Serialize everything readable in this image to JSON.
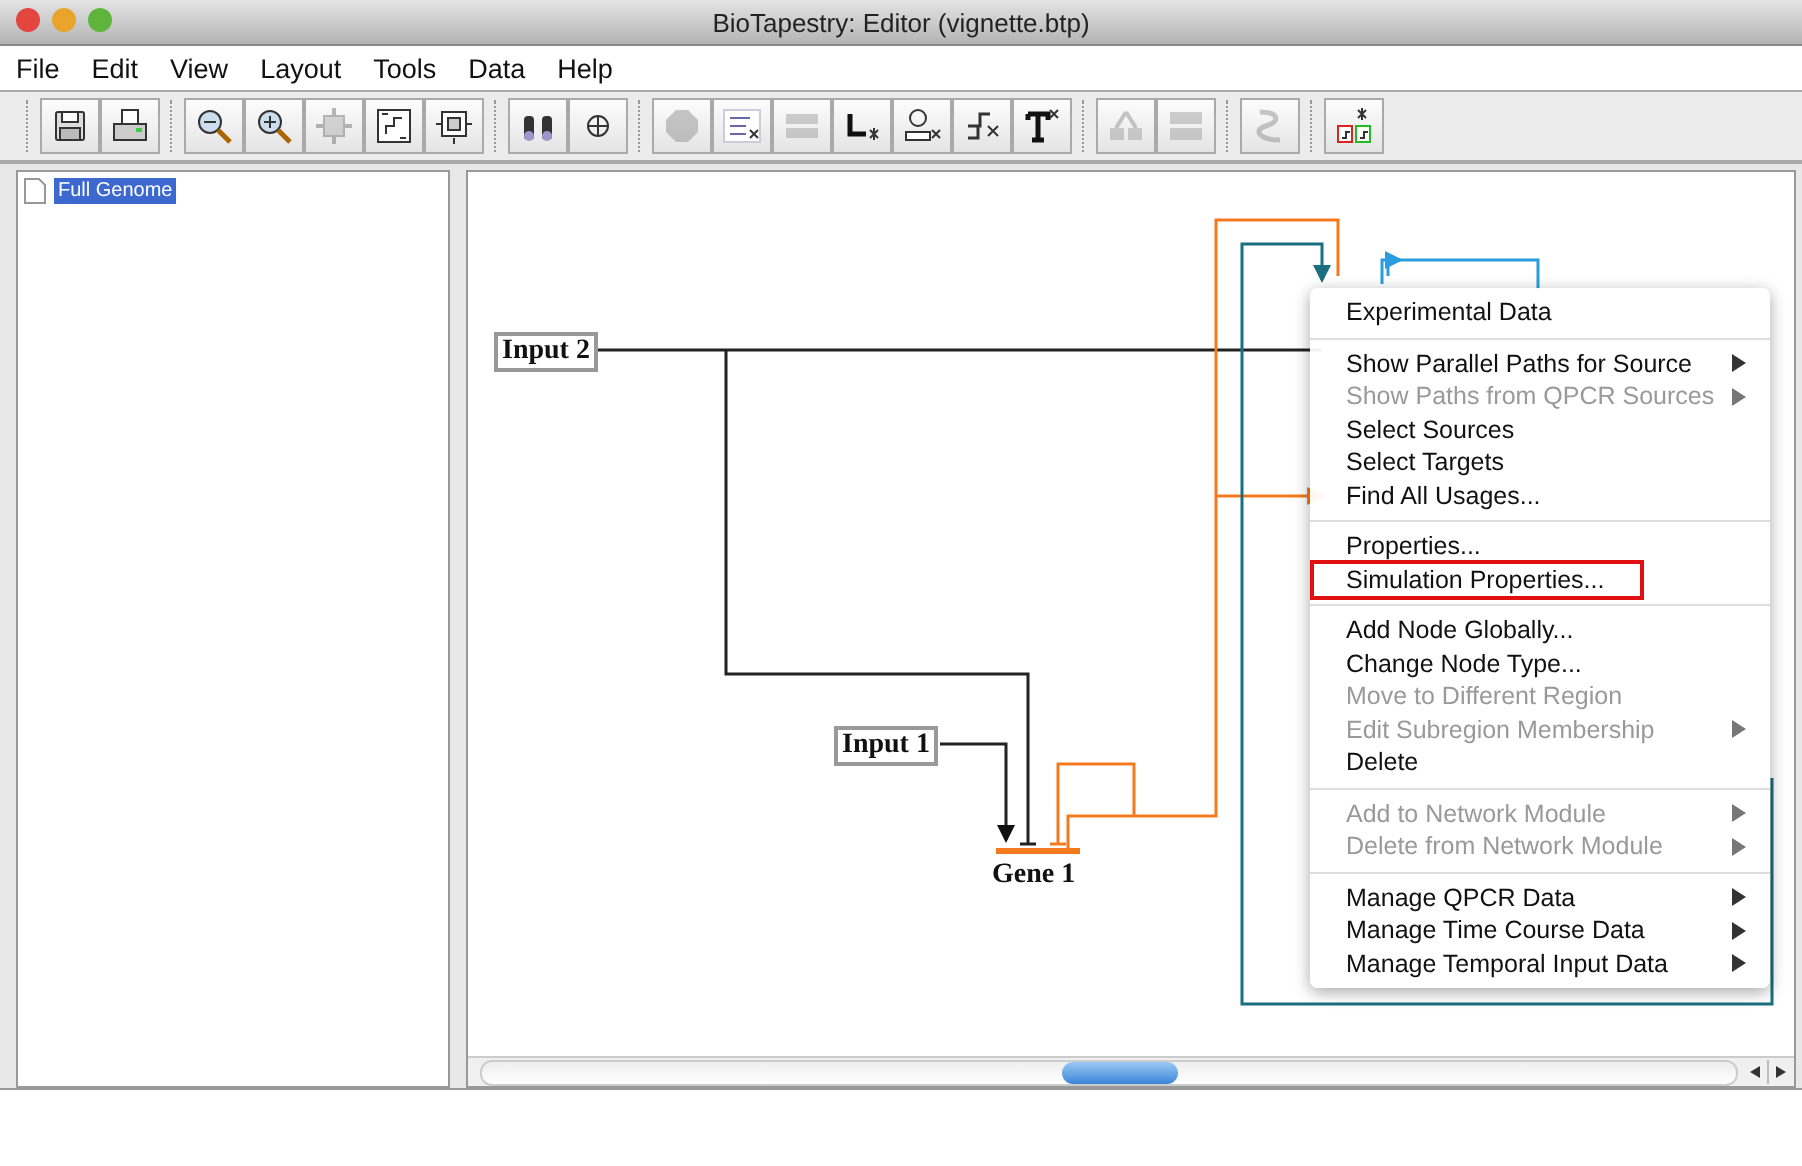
{
  "window": {
    "title": "BioTapestry: Editor (vignette.btp)"
  },
  "menu_bar": [
    "File",
    "Edit",
    "View",
    "Layout",
    "Tools",
    "Data",
    "Help"
  ],
  "toolbar": [
    [
      {
        "disabled": false
      },
      {
        "disabled": false
      }
    ],
    [
      {
        "disabled": false
      },
      {
        "disabled": false
      },
      {
        "disabled": true
      },
      {
        "disabled": false
      },
      {
        "disabled": false
      }
    ],
    [
      {
        "disabled": false
      },
      {
        "disabled": false
      }
    ],
    [
      {
        "disabled": true
      },
      {
        "disabled": false
      },
      {
        "disabled": true
      },
      {
        "disabled": false
      },
      {
        "disabled": false
      },
      {
        "disabled": false
      },
      {
        "disabled": false
      }
    ],
    [
      {
        "disabled": true
      },
      {
        "disabled": true
      }
    ],
    [
      {
        "disabled": true
      }
    ],
    [
      {
        "disabled": false
      }
    ]
  ],
  "tree": [
    {
      "label": "Full Genome",
      "selected": true
    }
  ],
  "diagram": {
    "nodes": [
      {
        "kind": "input",
        "label": "Input 2"
      },
      {
        "kind": "input",
        "label": "Input 1"
      },
      {
        "kind": "gene",
        "label": "Gene 1"
      }
    ]
  },
  "context_menu": [
    [
      {
        "label": "Experimental Data",
        "disabled": false,
        "submenu": false,
        "outlined": false
      }
    ],
    [
      {
        "label": "Show Parallel Paths for Source",
        "disabled": false,
        "submenu": true,
        "outlined": false
      },
      {
        "label": "Show Paths from QPCR Sources",
        "disabled": true,
        "submenu": true,
        "outlined": false
      },
      {
        "label": "Select Sources",
        "disabled": false,
        "submenu": false,
        "outlined": false
      },
      {
        "label": "Select Targets",
        "disabled": false,
        "submenu": false,
        "outlined": false
      },
      {
        "label": "Find All Usages...",
        "disabled": false,
        "submenu": false,
        "outlined": false
      }
    ],
    [
      {
        "label": "Properties...",
        "disabled": false,
        "submenu": false,
        "outlined": false
      },
      {
        "label": "Simulation Properties...",
        "disabled": false,
        "submenu": false,
        "outlined": true
      }
    ],
    [
      {
        "label": "Add Node Globally...",
        "disabled": false,
        "submenu": false,
        "outlined": false
      },
      {
        "label": "Change Node Type...",
        "disabled": false,
        "submenu": false,
        "outlined": false
      },
      {
        "label": "Move to Different Region",
        "disabled": true,
        "submenu": false,
        "outlined": false
      },
      {
        "label": "Edit Subregion Membership",
        "disabled": true,
        "submenu": true,
        "outlined": false
      },
      {
        "label": "Delete",
        "disabled": false,
        "submenu": false,
        "outlined": false
      }
    ],
    [
      {
        "label": "Add to Network Module",
        "disabled": true,
        "submenu": true,
        "outlined": false
      },
      {
        "label": "Delete from Network Module",
        "disabled": true,
        "submenu": true,
        "outlined": false
      }
    ],
    [
      {
        "label": "Manage QPCR Data",
        "disabled": false,
        "submenu": true,
        "outlined": false
      },
      {
        "label": "Manage Time Course Data",
        "disabled": false,
        "submenu": true,
        "outlined": false
      },
      {
        "label": "Manage Temporal Input Data",
        "disabled": false,
        "submenu": true,
        "outlined": false
      }
    ]
  ]
}
